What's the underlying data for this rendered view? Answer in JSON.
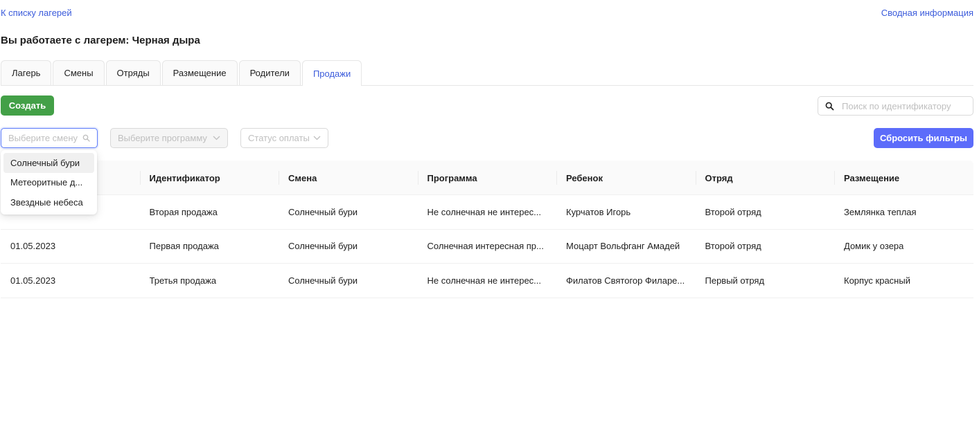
{
  "nav": {
    "back_label": "К списку лагерей",
    "summary_label": "Сводная информация"
  },
  "page_title": "Вы работаете с лагерем: Черная дыра",
  "tabs": [
    {
      "label": "Лагерь",
      "active": false
    },
    {
      "label": "Смены",
      "active": false
    },
    {
      "label": "Отряды",
      "active": false
    },
    {
      "label": "Размещение",
      "active": false
    },
    {
      "label": "Родители",
      "active": false
    },
    {
      "label": "Продажи",
      "active": true
    }
  ],
  "toolbar": {
    "create_label": "Создать",
    "search_placeholder": "Поиск по идентификатору"
  },
  "filters": {
    "shift_placeholder": "Выберите смену",
    "program_placeholder": "Выберите программу",
    "payment_placeholder": "Статус оплаты",
    "reset_label": "Сбросить фильтры"
  },
  "shift_dropdown": {
    "options": [
      "Солнечный бури",
      "Метеоритные д...",
      "Звездные небеса"
    ],
    "active_index": 0
  },
  "table": {
    "columns": [
      "",
      "Идентификатор",
      "Смена",
      "Программа",
      "Ребенок",
      "Отряд",
      "Размещение"
    ],
    "rows": [
      [
        "",
        "Вторая продажа",
        "Солнечный бури",
        "Не солнечная не интерес...",
        "Курчатов Игорь",
        "Второй отряд",
        "Землянка теплая"
      ],
      [
        "01.05.2023",
        "Первая продажа",
        "Солнечный бури",
        "Солнечная интересная пр...",
        "Моцарт Вольфганг Амадей",
        "Второй отряд",
        "Домик у озера"
      ],
      [
        "01.05.2023",
        "Третья продажа",
        "Солнечный бури",
        "Не солнечная не интерес...",
        "Филатов Святогор Филаре...",
        "Первый отряд",
        "Корпус красный"
      ]
    ]
  },
  "colors": {
    "link": "#3b5bdb",
    "create_button": "#43a047",
    "reset_button": "#5c6cfa",
    "active_tab": "#3b5bdb"
  },
  "icons": {
    "search": "search-icon",
    "chevron": "chevron-down-icon"
  }
}
